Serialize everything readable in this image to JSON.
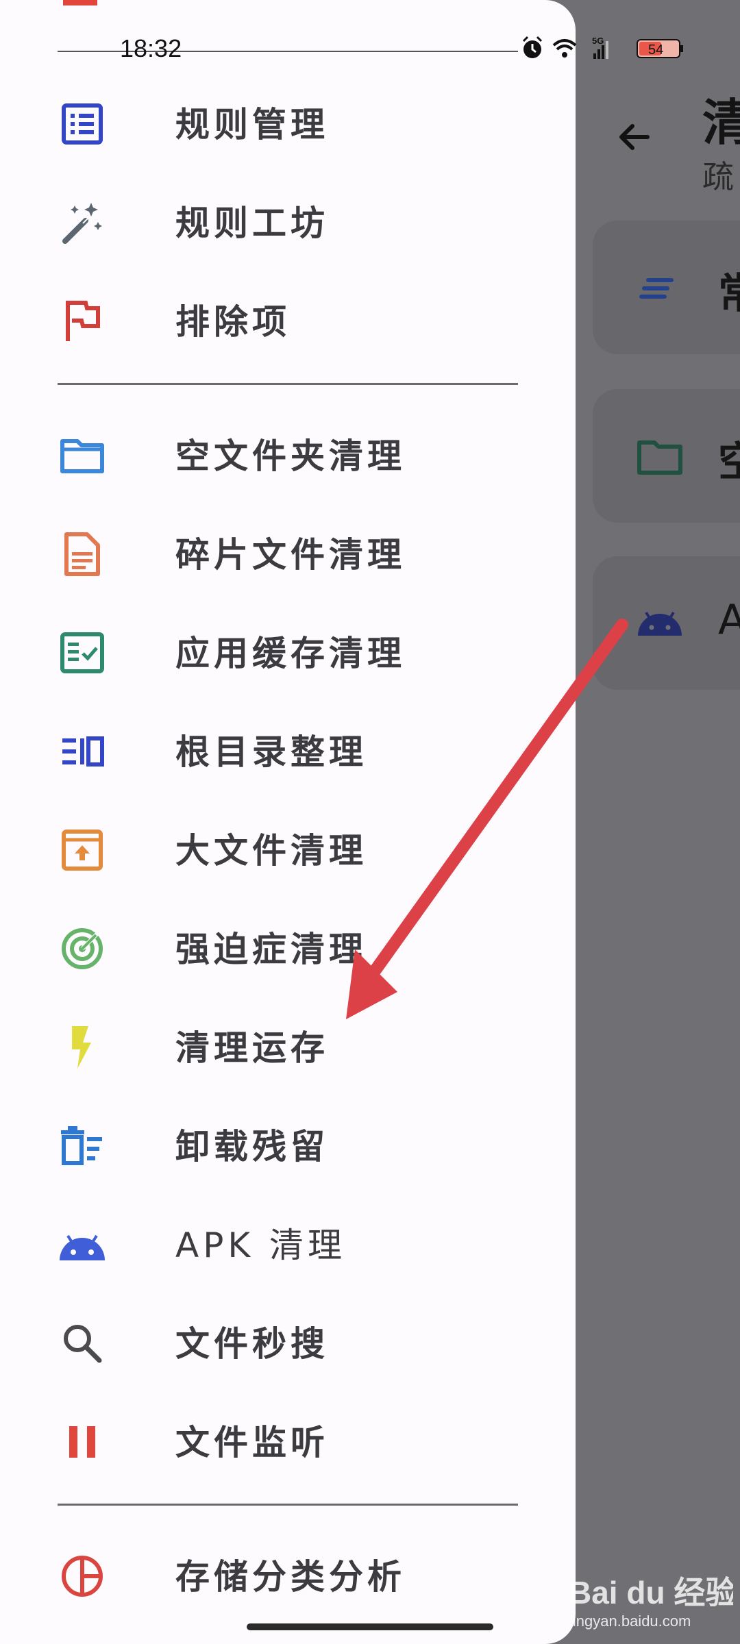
{
  "status_bar": {
    "time": "18:32",
    "battery": "54",
    "network": "5G"
  },
  "background_app": {
    "title": "清",
    "subtitle": "疏",
    "cards": [
      {
        "text": "常",
        "icon": "lines-icon"
      },
      {
        "text": "空",
        "icon": "folder-icon"
      },
      {
        "text": "A",
        "icon": "android-icon"
      }
    ]
  },
  "drawer": {
    "groups": [
      [
        {
          "label": "规则管理",
          "icon": "list-icon",
          "color": "#3346c8"
        },
        {
          "label": "规则工坊",
          "icon": "magic-wand-icon",
          "color": "#5b6670"
        },
        {
          "label": "排除项",
          "icon": "flag-icon",
          "color": "#d23f3a"
        }
      ],
      [
        {
          "label": "空文件夹清理",
          "icon": "folder-icon",
          "color": "#3b87d9"
        },
        {
          "label": "碎片文件清理",
          "icon": "document-icon",
          "color": "#e2784f"
        },
        {
          "label": "应用缓存清理",
          "icon": "checklist-icon",
          "color": "#2e8a6e"
        },
        {
          "label": "根目录整理",
          "icon": "root-list-icon",
          "color": "#3346c8"
        },
        {
          "label": "大文件清理",
          "icon": "archive-icon",
          "color": "#e38b3b"
        },
        {
          "label": "强迫症清理",
          "icon": "radar-icon",
          "color": "#67b36a"
        },
        {
          "label": "清理运存",
          "icon": "flash-icon",
          "color": "#e0dc3e"
        },
        {
          "label": "卸载残留",
          "icon": "delete-list-icon",
          "color": "#2f78d2"
        },
        {
          "label": "APK 清理",
          "icon": "android-icon",
          "color": "#3f5ed7"
        },
        {
          "label": "文件秒搜",
          "icon": "search-icon",
          "color": "#4b4b4f"
        },
        {
          "label": "文件监听",
          "icon": "pause-icon",
          "color": "#e0463c"
        }
      ],
      [
        {
          "label": "存储分类分析",
          "icon": "pie-icon",
          "color": "#d9463f"
        }
      ]
    ]
  },
  "annotation": {
    "arrow_color": "#dd4148"
  },
  "watermark": {
    "brand": "Bai du 经验",
    "url": "jingyan.baidu.com"
  }
}
